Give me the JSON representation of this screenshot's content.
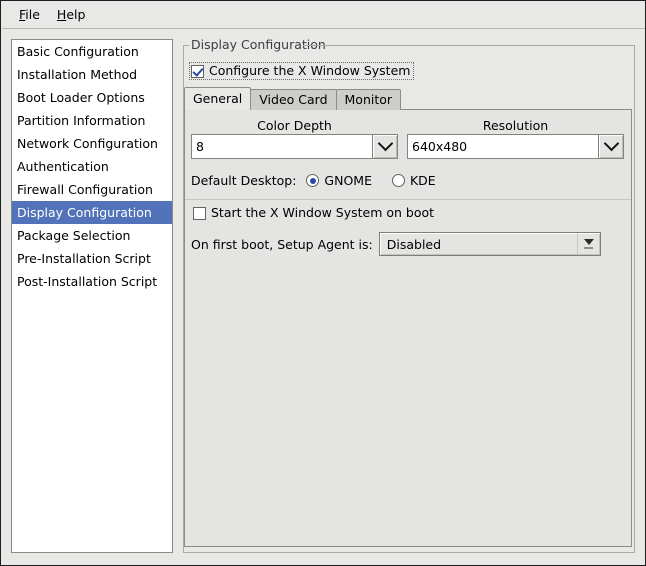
{
  "menubar": {
    "items": [
      {
        "mnemonic": "F",
        "rest": "ile"
      },
      {
        "mnemonic": "H",
        "rest": "elp"
      }
    ]
  },
  "sidebar": {
    "items": [
      {
        "label": "Basic Configuration",
        "selected": false
      },
      {
        "label": "Installation Method",
        "selected": false
      },
      {
        "label": "Boot Loader Options",
        "selected": false
      },
      {
        "label": "Partition Information",
        "selected": false
      },
      {
        "label": "Network Configuration",
        "selected": false
      },
      {
        "label": "Authentication",
        "selected": false
      },
      {
        "label": "Firewall Configuration",
        "selected": false
      },
      {
        "label": "Display Configuration",
        "selected": true
      },
      {
        "label": "Package Selection",
        "selected": false
      },
      {
        "label": "Pre-Installation Script",
        "selected": false
      },
      {
        "label": "Post-Installation Script",
        "selected": false
      }
    ]
  },
  "panel": {
    "group_title": "Display Configuration",
    "configure_x_checkbox": {
      "label": "Configure the X Window System",
      "checked": true
    },
    "tabs": [
      {
        "label": "General",
        "active": true
      },
      {
        "label": "Video Card",
        "active": false
      },
      {
        "label": "Monitor",
        "active": false
      }
    ],
    "color_depth": {
      "label": "Color Depth",
      "value": "8"
    },
    "resolution": {
      "label": "Resolution",
      "value": "640x480"
    },
    "default_desktop": {
      "label": "Default Desktop:",
      "options": [
        {
          "label": "GNOME",
          "selected": true
        },
        {
          "label": "KDE",
          "selected": false
        }
      ]
    },
    "start_on_boot": {
      "label": "Start the X Window System on boot",
      "checked": false
    },
    "setup_agent": {
      "label": "On first boot, Setup Agent is:",
      "value": "Disabled"
    }
  },
  "colors": {
    "selection": "#5273ba",
    "window_bg": "#e8e8e7",
    "panel_bg": "#e4e4e3",
    "accent_check": "#2a49a8"
  }
}
